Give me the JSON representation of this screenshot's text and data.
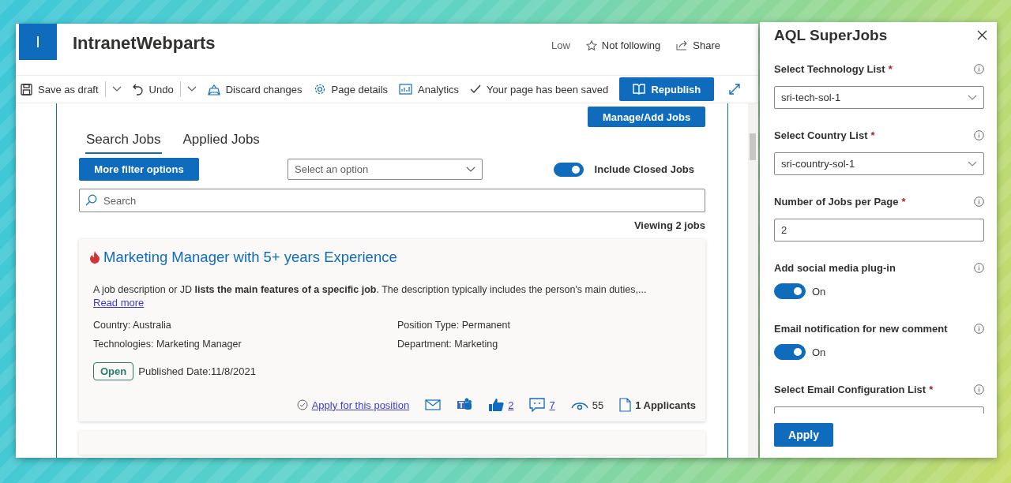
{
  "site": {
    "logo_letter": "I",
    "title": "IntranetWebparts",
    "actions": [
      {
        "kind": "text",
        "label": "Low"
      },
      {
        "kind": "follow",
        "label": "Not following"
      },
      {
        "kind": "share",
        "label": "Share"
      }
    ]
  },
  "toolbar": {
    "items": [
      {
        "kind": "save",
        "label": "Save as draft",
        "has_menu": true
      },
      {
        "kind": "undo",
        "label": "Undo",
        "has_menu": true
      },
      {
        "kind": "discard",
        "label": "Discard changes",
        "has_menu": false
      },
      {
        "kind": "details",
        "label": "Page details",
        "has_menu": false
      },
      {
        "kind": "analytics",
        "label": "Analytics",
        "has_menu": false
      },
      {
        "kind": "status",
        "label": "Your page has been saved",
        "has_menu": false
      }
    ],
    "primary": "Republish"
  },
  "jobs": {
    "manage_button": "Manage/Add Jobs",
    "tabs": [
      {
        "label": "Search Jobs",
        "selected": true
      },
      {
        "label": "Applied Jobs",
        "selected": false
      }
    ],
    "filter_button": "More filter options",
    "dropdown": {
      "placeholder": "Select an option"
    },
    "include_closed": {
      "label": "Include Closed Jobs",
      "on": true
    },
    "search": {
      "placeholder": "Search"
    },
    "count": "Viewing 2 jobs",
    "cards": [
      {
        "hot": true,
        "title": "Marketing Manager with 5+ years Experience",
        "description": "A job description or JD **lists the main features of a specific job**. The description typically includes the person's main duties,...",
        "read_more": "Read more",
        "fields": [
          "Country: Australia",
          "Position Type: Permanent",
          "Technologies: Marketing Manager",
          "Department: Marketing"
        ],
        "status": "Open",
        "published": "Published Date:11/8/2021",
        "apply": "Apply for this position",
        "likes": "2",
        "comments": "7",
        "views": "55",
        "applicants": "1 Applicants"
      }
    ]
  },
  "panel": {
    "title": "AQL SuperJobs",
    "fields": [
      {
        "kind": "dropdown",
        "label": "Select Technology List",
        "required_mark": "*",
        "value": "sri-tech-sol-1"
      },
      {
        "kind": "dropdown",
        "label": "Select Country List",
        "required_mark": "*",
        "value": "sri-country-sol-1"
      },
      {
        "kind": "text",
        "label": "Number of Jobs per Page",
        "required_mark": "*",
        "value": "2"
      },
      {
        "kind": "toggle",
        "label": "Add social media plug-in",
        "on": true,
        "state_label": "On"
      },
      {
        "kind": "toggle",
        "label": "Email notification for new comment",
        "on": true,
        "state_label": "On"
      },
      {
        "kind": "dropdown",
        "label": "Select Email Configuration List",
        "required_mark": "*"
      }
    ],
    "apply": "Apply"
  }
}
